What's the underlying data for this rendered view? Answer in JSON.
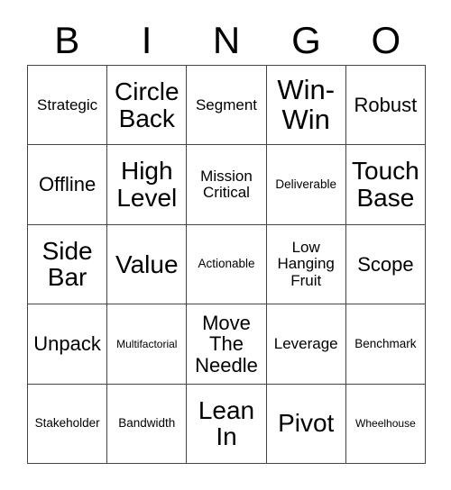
{
  "card": {
    "title": "BINGO",
    "headers": [
      "B",
      "I",
      "N",
      "G",
      "O"
    ],
    "grid_color": "#444444",
    "text_color": "#000000",
    "background": "#ffffff",
    "rows": [
      [
        {
          "text": "Strategic",
          "size": "sm"
        },
        {
          "text": "Circle\nBack",
          "size": "lg"
        },
        {
          "text": "Segment",
          "size": "sm"
        },
        {
          "text": "Win-\nWin",
          "size": "xl"
        },
        {
          "text": "Robust",
          "size": "md"
        }
      ],
      [
        {
          "text": "Offline",
          "size": "md"
        },
        {
          "text": "High\nLevel",
          "size": "lg"
        },
        {
          "text": "Mission\nCritical",
          "size": "sm"
        },
        {
          "text": "Deliverable",
          "size": "xs"
        },
        {
          "text": "Touch\nBase",
          "size": "lg"
        }
      ],
      [
        {
          "text": "Side\nBar",
          "size": "lg"
        },
        {
          "text": "Value",
          "size": "lg"
        },
        {
          "text": "Actionable",
          "size": "xs"
        },
        {
          "text": "Low\nHanging\nFruit",
          "size": "sm"
        },
        {
          "text": "Scope",
          "size": "md"
        }
      ],
      [
        {
          "text": "Unpack",
          "size": "md"
        },
        {
          "text": "Multifactorial",
          "size": "xxs"
        },
        {
          "text": "Move\nThe\nNeedle",
          "size": "md"
        },
        {
          "text": "Leverage",
          "size": "sm"
        },
        {
          "text": "Benchmark",
          "size": "xs"
        }
      ],
      [
        {
          "text": "Stakeholder",
          "size": "xs"
        },
        {
          "text": "Bandwidth",
          "size": "xs"
        },
        {
          "text": "Lean\nIn",
          "size": "lg"
        },
        {
          "text": "Pivot",
          "size": "lg"
        },
        {
          "text": "Wheelhouse",
          "size": "xxs"
        }
      ]
    ]
  }
}
